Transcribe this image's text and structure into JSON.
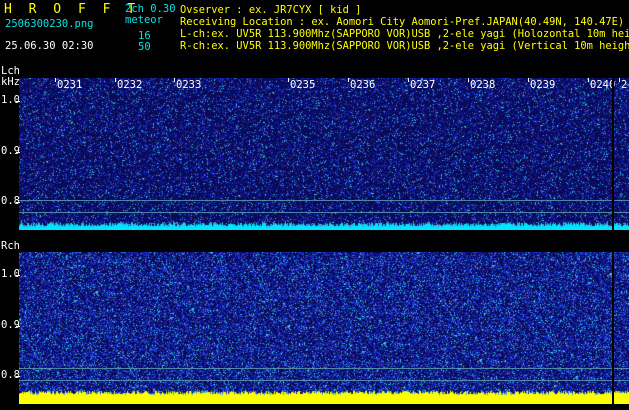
{
  "header": {
    "title": "H R O F F T",
    "mode": "2ch 0.30",
    "filename": "2506300230.png",
    "meteor_label": "meteor",
    "timestamp": "25.06.30 02:30",
    "count_l": "16",
    "count_r": "50"
  },
  "info": {
    "observer": "Ovserver            : ex. JR7CYX [ kid ]",
    "location": "Receiving Location : ex. Aomori City Aomori-Pref.JAPAN(40.49N, 140.47E)",
    "lch": "L-ch:ex. UV5R 113.900Mhz(SAPPORO VOR)USB ,2-ele yagi (Holozontal 10m height)",
    "rch": "R-ch:ex. UV5R 113.900Mhz(SAPPORO VOR)USB ,2-ele yagi (Vertical 10m height)"
  },
  "lch_panel": {
    "label": "Lch",
    "unit": "kHz",
    "yticks": [
      "1.0",
      "0.9",
      "0.8"
    ]
  },
  "rch_panel": {
    "label": "Rch",
    "yticks": [
      "1.0",
      "0.9",
      "0.8"
    ]
  },
  "time_labels": [
    "0231",
    "0232",
    "0233",
    "0235",
    "0236",
    "0237",
    "0238",
    "0239",
    "0240",
    "2"
  ],
  "colors": {
    "background": "#000000",
    "header_yellow": "#ffff00",
    "header_cyan": "#00e5e5",
    "spectrum_base": "#0b0b60",
    "lch_floor": "#00e5ff",
    "rch_floor": "#ffff00"
  }
}
